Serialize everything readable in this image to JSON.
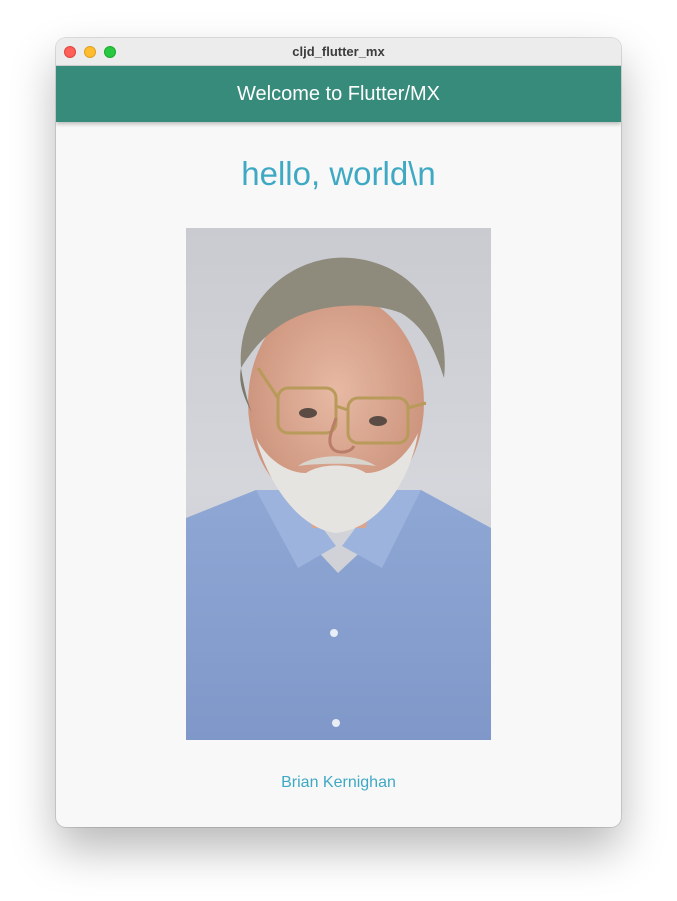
{
  "window": {
    "title": "cljd_flutter_mx"
  },
  "appbar": {
    "title": "Welcome to Flutter/MX",
    "color": "#378b7b"
  },
  "main": {
    "greeting": "hello, world\\n",
    "accent_color": "#3fa9c4",
    "portrait_caption": "Brian Kernighan"
  }
}
